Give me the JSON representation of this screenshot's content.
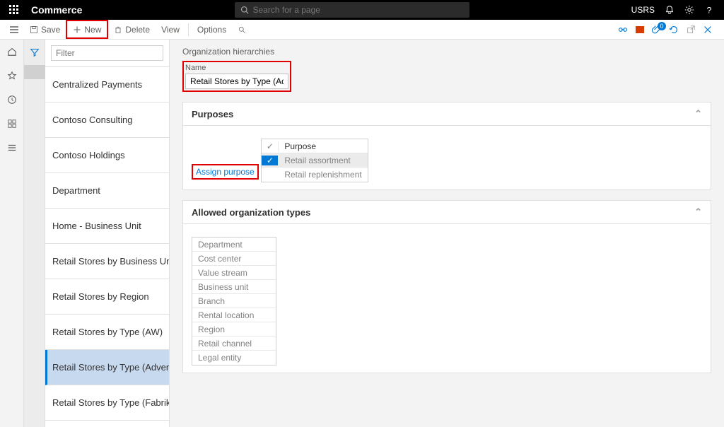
{
  "app": {
    "brand": "Commerce",
    "search_placeholder": "Search for a page",
    "user": "USRS"
  },
  "cmd": {
    "save": "Save",
    "new": "New",
    "delete": "Delete",
    "view": "View",
    "options": "Options"
  },
  "list": {
    "filter_placeholder": "Filter",
    "items": [
      {
        "label": "Centralized Payments"
      },
      {
        "label": "Contoso Consulting"
      },
      {
        "label": "Contoso Holdings"
      },
      {
        "label": "Department"
      },
      {
        "label": "Home - Business Unit"
      },
      {
        "label": "Retail Stores by Business Unit"
      },
      {
        "label": "Retail Stores by Region"
      },
      {
        "label": "Retail Stores by Type (AW)"
      },
      {
        "label": "Retail Stores by Type (Advent"
      },
      {
        "label": "Retail Stores by Type (Fabrik..."
      }
    ],
    "selected_index": 8
  },
  "detail": {
    "crumb": "Organization hierarchies",
    "name_label": "Name",
    "name_value": "Retail Stores by Type (Adventur...",
    "purposes": {
      "title": "Purposes",
      "assign": "Assign purpose",
      "header": "Purpose",
      "rows": [
        {
          "label": "Retail assortment",
          "selected": true
        },
        {
          "label": "Retail replenishment",
          "selected": false
        }
      ]
    },
    "orgtypes": {
      "title": "Allowed organization types",
      "rows": [
        "Department",
        "Cost center",
        "Value stream",
        "Business unit",
        "Branch",
        "Rental location",
        "Region",
        "Retail channel",
        "Legal entity"
      ]
    }
  }
}
